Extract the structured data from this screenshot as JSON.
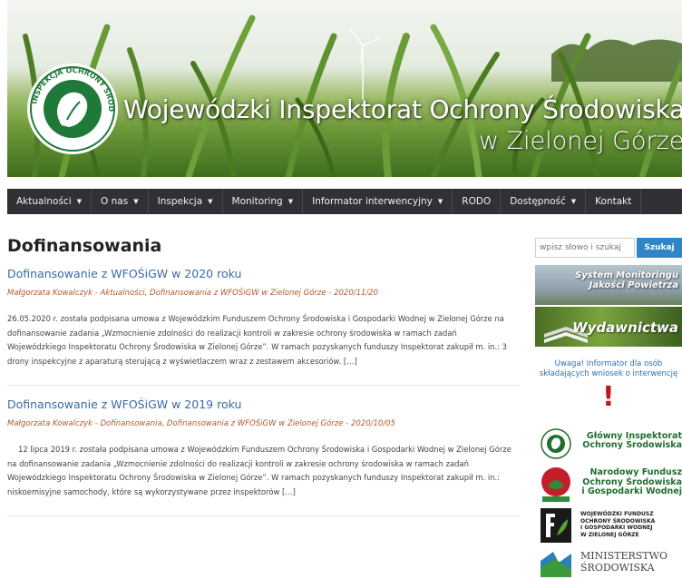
{
  "banner": {
    "title": "Wojewódzki Inspektorat Ochrony Środowiska",
    "subtitle": "w Zielonej Górze",
    "logo_text": "INSPEKCJA OCHRONY ŚRODOWISKA",
    "colors": {
      "sky": "#eef2ec",
      "crop": "#5f8f2e"
    }
  },
  "nav": {
    "items": [
      {
        "label": "Aktualności",
        "dropdown": true
      },
      {
        "label": "O nas",
        "dropdown": true
      },
      {
        "label": "Inspekcja",
        "dropdown": true
      },
      {
        "label": "Monitoring",
        "dropdown": true
      },
      {
        "label": "Informator interwencyjny",
        "dropdown": true
      },
      {
        "label": "RODO",
        "dropdown": false
      },
      {
        "label": "Dostępność",
        "dropdown": true
      },
      {
        "label": "Kontakt",
        "dropdown": false
      }
    ],
    "background": "#2f3135"
  },
  "main": {
    "page_title": "Dofinansowania",
    "posts": [
      {
        "title": "Dofinansowanie z WFOŚiGW w 2020 roku",
        "author": "Małgorzata Kowalczyk",
        "categories": "Aktualności, Dofinansowania z WFOŚiGW w Zielonej Górze",
        "date": "2020/11/20",
        "body": "26.05.2020 r. została podpisana umowa z Wojewódzkim Funduszem Ochrony Środowiska i Gospodarki Wodnej w Zielonej Górze na dofinansowanie zadania „Wzmocnienie zdolności do realizacji kontroli w zakresie ochrony środowiska w ramach zadań Wojewódzkiego Inspektoratu Ochrony Środowiska w Zielonej Górze”. W ramach pozyskanych funduszy Inspektorat zakupił m. in.: 3 drony inspekcyjne z aparaturą sterującą z wyświetlaczem wraz z zestawem akcesoriów. […]"
      },
      {
        "title": "Dofinansowanie z WFOŚiGW w 2019 roku",
        "author": "Małgorzata Kowalczyk",
        "categories": "Dofinansowania, Dofinansowania z WFOŚiGW w Zielonej Górze",
        "date": "2020/10/05",
        "body": "12 lipca 2019 r. została podpisana umowa z Wojewódzkim Funduszem Ochrony Środowiska i Gospodarki Wodnej w Zielonej Górze na dofinansowanie zadania „Wzmocnienie zdolności do realizacji kontroli w zakresie ochrony środowiska w ramach zadań Wojewódzkiego Inspektoratu Ochrony Środowiska w Zielonej Górze”. W ramach pozyskanych funduszy Inspektorat zakupił m. in.: niskoemisyjne samochody, które są wykorzystywane przez inspektorów […]"
      }
    ],
    "title_color": "#3a6aa8",
    "meta_color": "#b05a2b"
  },
  "sidebar": {
    "search": {
      "placeholder": "wpisz słowo i szukaj",
      "button": "Szukaj"
    },
    "banner_monitoring": {
      "line1": "System Monitoringu",
      "line2": "Jakości Powietrza"
    },
    "banner_publications": {
      "label": "Wydawnictwa"
    },
    "notice": {
      "line1": "Uwaga! Informator dla osób",
      "line2": "składających wniosek o interwencję"
    },
    "notice_icon": "exclamation-icon",
    "partners": [
      {
        "name": "Główny Inspektorat Ochrony Środowiska",
        "line1": "Główny Inspektorat",
        "line2": "Ochrony Środowiska",
        "color": "#1f6e2e"
      },
      {
        "name": "Narodowy Fundusz Ochrony Środowiska i Gospodarki Wodnej",
        "line1": "Narodowy Fundusz",
        "line2": "Ochrony Środowiska",
        "line3": "i Gospodarki Wodnej",
        "color": "#1f6e2e"
      },
      {
        "name": "Wojewódzki Fundusz Ochrony Środowiska i Gospodarki Wodnej w Zielonej Górze",
        "line1": "WOJEWÓDZKI FUNDUSZ",
        "line2": "OCHRONY ŚRODOWISKA",
        "line3": "I GOSPODARKI WODNEJ",
        "line4": "W ZIELONEJ GÓRZE",
        "color": "#222222"
      },
      {
        "name": "Ministerstwo Środowiska",
        "line1": "MINISTERSTWO",
        "line2": "ŚRODOWISKA",
        "color": "#444444"
      }
    ]
  }
}
